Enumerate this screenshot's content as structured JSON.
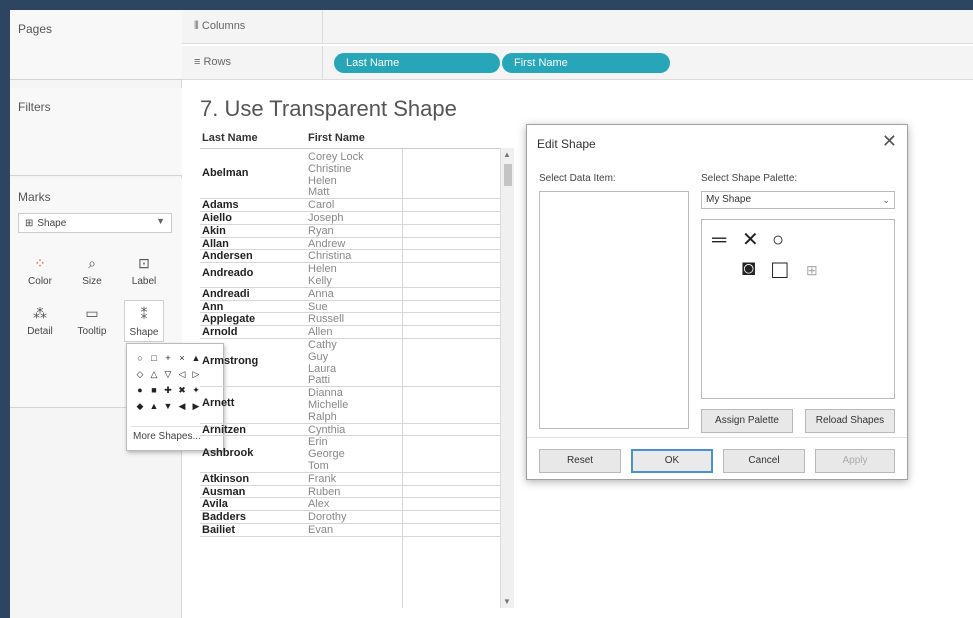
{
  "cards": {
    "pages": "Pages",
    "filters": "Filters",
    "marks": "Marks",
    "mark_type": "Shape"
  },
  "mark_buttons": [
    {
      "label": "Color",
      "icon": "color-icon"
    },
    {
      "label": "Size",
      "icon": "size-icon"
    },
    {
      "label": "Label",
      "icon": "label-icon"
    },
    {
      "label": "Detail",
      "icon": "detail-icon"
    },
    {
      "label": "Tooltip",
      "icon": "tooltip-icon"
    },
    {
      "label": "Shape",
      "icon": "shape-icon"
    }
  ],
  "shape_popup": {
    "more": "More Shapes..."
  },
  "shelves": {
    "columns": "Columns",
    "rows": "Rows",
    "pills": [
      "Last Name",
      "First Name"
    ]
  },
  "view": {
    "title": "7. Use Transparent Shape",
    "headers": [
      "Last Name",
      "First Name"
    ],
    "rows": [
      {
        "last": "Abelman",
        "first": [
          "Corey Lock",
          "Christine",
          "Helen",
          "Matt"
        ]
      },
      {
        "last": "Adams",
        "first": [
          "Carol"
        ]
      },
      {
        "last": "Aiello",
        "first": [
          "Joseph"
        ]
      },
      {
        "last": "Akin",
        "first": [
          "Ryan"
        ]
      },
      {
        "last": "Allan",
        "first": [
          "Andrew"
        ]
      },
      {
        "last": "Andersen",
        "first": [
          "Christina"
        ]
      },
      {
        "last": "Andreado",
        "first": [
          "Helen",
          "Kelly"
        ]
      },
      {
        "last": "Andreadi",
        "first": [
          "Anna"
        ]
      },
      {
        "last": "Ann",
        "first": [
          "Sue"
        ]
      },
      {
        "last": "Applegate",
        "first": [
          "Russell"
        ]
      },
      {
        "last": "Arnold",
        "first": [
          "Allen"
        ]
      },
      {
        "last": "Armstrong",
        "first": [
          "Cathy",
          "Guy",
          "Laura",
          "Patti"
        ]
      },
      {
        "last": "Arnett",
        "first": [
          "Dianna",
          "Michelle",
          "Ralph"
        ]
      },
      {
        "last": "Arnitzen",
        "first": [
          "Cynthia"
        ]
      },
      {
        "last": "Ashbrook",
        "first": [
          "Erin",
          "George",
          "Tom"
        ]
      },
      {
        "last": "Atkinson",
        "first": [
          "Frank"
        ]
      },
      {
        "last": "Ausman",
        "first": [
          "Ruben"
        ]
      },
      {
        "last": "Avila",
        "first": [
          "Alex"
        ]
      },
      {
        "last": "Badders",
        "first": [
          "Dorothy"
        ]
      },
      {
        "last": "Bailiet",
        "first": [
          "Evan"
        ]
      }
    ]
  },
  "dialog": {
    "title": "Edit Shape",
    "select_data_item": "Select Data Item:",
    "select_palette": "Select Shape Palette:",
    "palette_value": "My Shape",
    "assign_palette": "Assign Palette",
    "reload_shapes": "Reload Shapes",
    "reset": "Reset",
    "ok": "OK",
    "cancel": "Cancel",
    "apply": "Apply"
  }
}
